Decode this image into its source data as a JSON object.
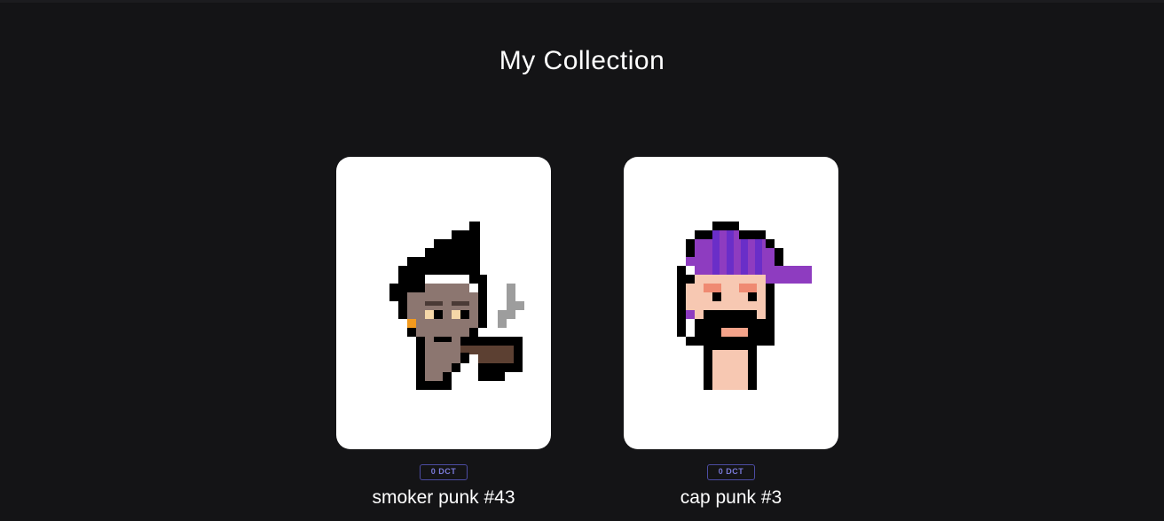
{
  "page": {
    "title": "My Collection"
  },
  "collection": [
    {
      "name": "smoker punk #43",
      "price": "0 DCT",
      "icon": "smoker-punk-icon"
    },
    {
      "name": "cap punk #3",
      "price": "0 DCT",
      "icon": "cap-punk-icon"
    }
  ],
  "colors": {
    "background": "#141416",
    "card": "#ffffff",
    "badge_border": "#4c4ca3",
    "badge_text": "#7a7ad9"
  }
}
